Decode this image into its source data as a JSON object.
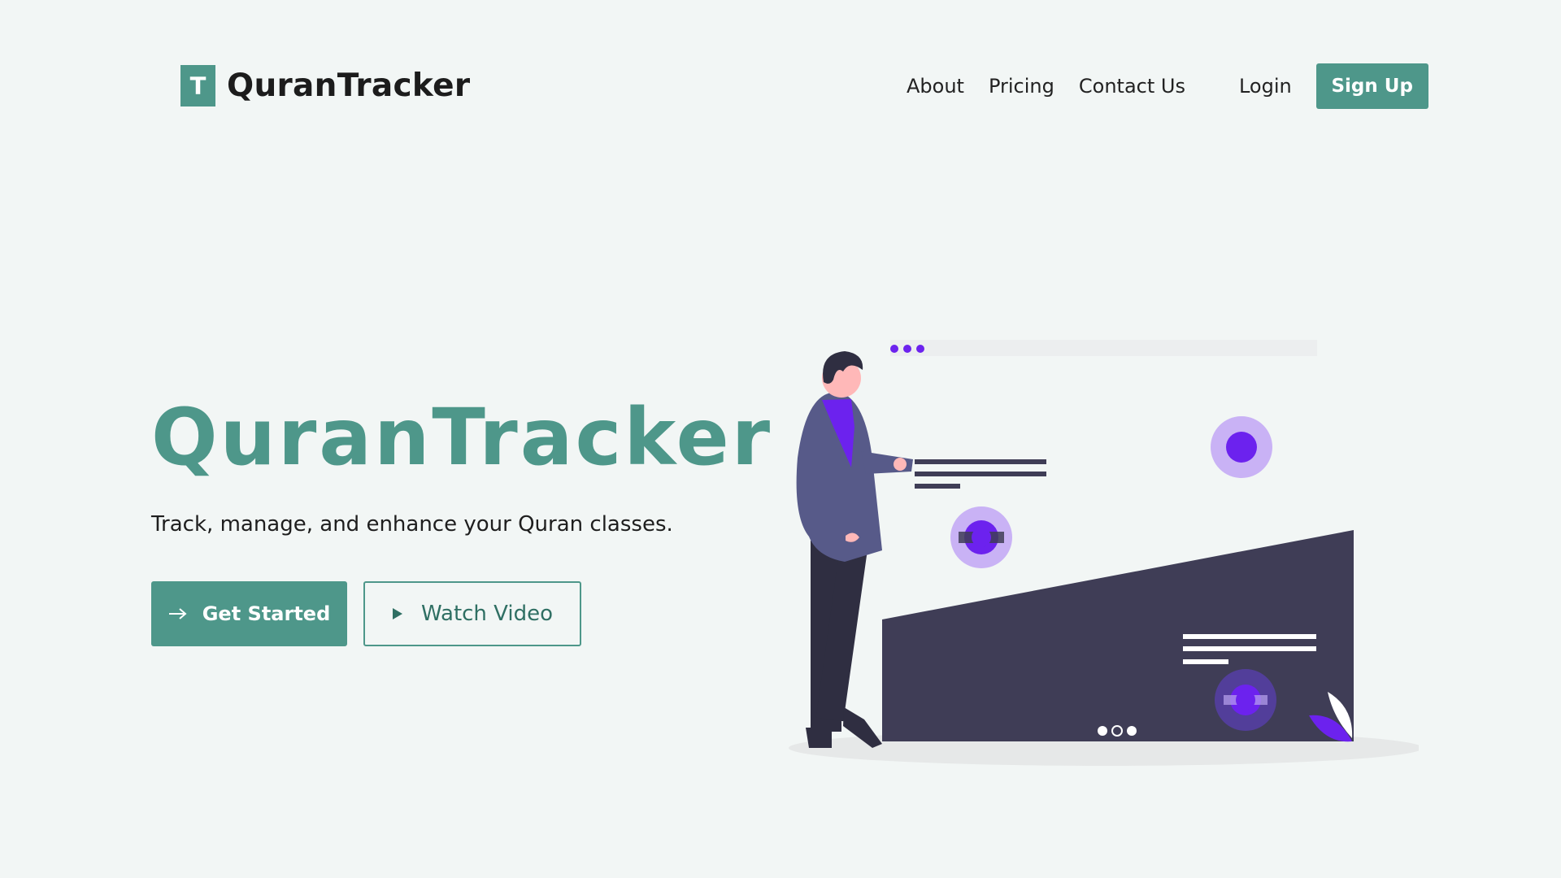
{
  "brand": {
    "logo_letter": "T",
    "name": "QuranTracker"
  },
  "nav": {
    "about": "About",
    "pricing": "Pricing",
    "contact": "Contact Us",
    "login": "Login",
    "signup": "Sign Up"
  },
  "hero": {
    "title": "QuranTracker",
    "subtitle": "Track, manage, and enhance your Quran classes.",
    "primary_button": "Get Started",
    "primary_icon": "arrow-right-icon",
    "secondary_button": "Watch Video",
    "secondary_icon": "play-icon"
  },
  "colors": {
    "accent": "#4e978a",
    "background": "#f2f6f5",
    "illustration_purple": "#6c22ee",
    "illustration_dark": "#3f3d56"
  }
}
